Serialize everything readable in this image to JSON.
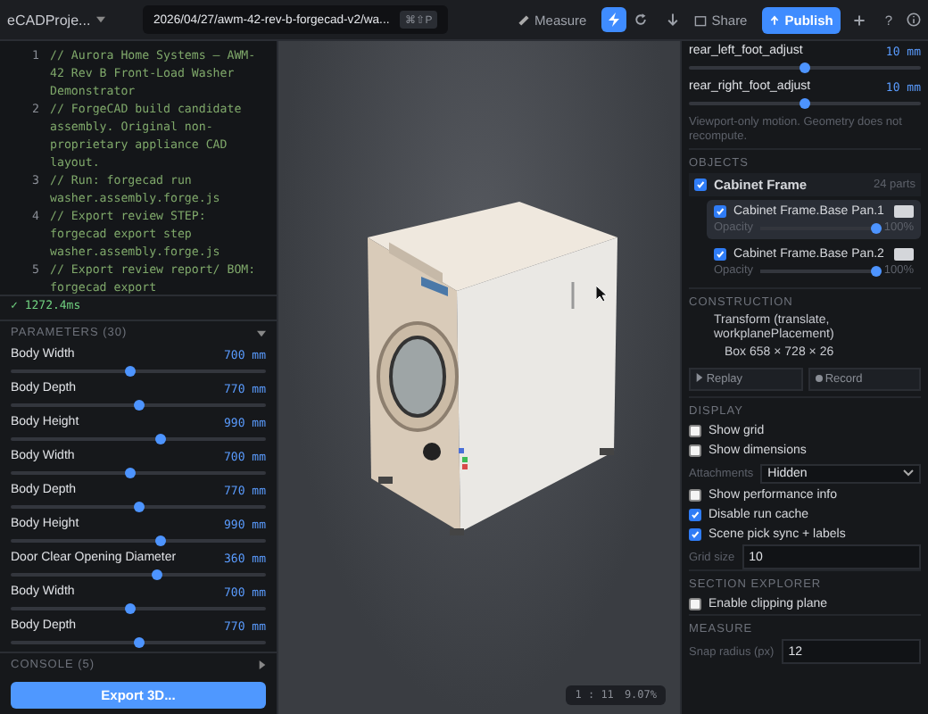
{
  "toolbar": {
    "project": "eCADProje...",
    "path": "2026/04/27/awm-42-rev-b-forgecad-v2/wa...",
    "path_shortcut": "⌘⇧P",
    "measure": "Measure",
    "run_active": true,
    "share": "Share",
    "publish": "Publish",
    "help": "?"
  },
  "editor": {
    "lines": [
      {
        "number": "1",
        "text": "// Aurora Home Systems — AWM-42 Rev B Front-Load Washer Demonstrator"
      },
      {
        "number": "2",
        "text": "// ForgeCAD build candidate assembly. Original non-proprietary appliance CAD layout."
      },
      {
        "number": "3",
        "text": "// Run: forgecad run washer.assembly.forge.js"
      },
      {
        "number": "4",
        "text": "// Export review STEP: forgecad export step washer.assembly.forge.js"
      },
      {
        "number": "5",
        "text": "// Export review report/ BOM: forgecad export"
      }
    ],
    "status": "✓ 1272.4ms"
  },
  "parameters": {
    "title": "PARAMETERS (30)",
    "items": [
      {
        "name": "Body Width",
        "value": "700 mm",
        "level": 0.47
      },
      {
        "name": "Body Depth",
        "value": "770 mm",
        "level": 0.5
      },
      {
        "name": "Body Height",
        "value": "990 mm",
        "level": 0.59
      },
      {
        "name": "Body Width",
        "value": "700 mm",
        "level": 0.47
      },
      {
        "name": "Body Depth",
        "value": "770 mm",
        "level": 0.5
      },
      {
        "name": "Body Height",
        "value": "990 mm",
        "level": 0.59
      },
      {
        "name": "Door Clear Opening Diameter",
        "value": "360 mm",
        "level": 0.57
      },
      {
        "name": "Body Width",
        "value": "700 mm",
        "level": 0.47
      },
      {
        "name": "Body Depth",
        "value": "770 mm",
        "level": 0.5
      }
    ]
  },
  "console": {
    "title": "CONSOLE (5)"
  },
  "export_button": "Export 3D...",
  "viewport": {
    "scale": "1 : 11",
    "zoom": "9.07%"
  },
  "inspector": {
    "adjusters": [
      {
        "name": "rear_left_foot_adjust",
        "value": "10 mm",
        "level": 0.5
      },
      {
        "name": "rear_right_foot_adjust",
        "value": "10 mm",
        "level": 0.5
      }
    ],
    "note": "Viewport-only motion. Geometry does not recompute.",
    "objects": {
      "title": "OBJECTS",
      "name": "Cabinet Frame",
      "checked": true,
      "count": "24 parts",
      "children": [
        {
          "name": "Cabinet Frame.Base Pan.1",
          "checked": true,
          "opacity_label": "Opacity",
          "level": 1,
          "reading": "100%",
          "selected": true
        },
        {
          "name": "Cabinet Frame.Base Pan.2",
          "checked": true,
          "opacity_label": "Opacity",
          "level": 1,
          "reading": "100%",
          "selected": false
        }
      ]
    },
    "construction": {
      "title": "CONSTRUCTION",
      "step": "Transform (translate, workplanePlacement)",
      "children": [
        {
          "label": "Box 658 × 728 × 26"
        }
      ],
      "replay": "Replay",
      "record": "Record"
    },
    "display": {
      "title": "DISPLAY",
      "items": [
        {
          "kind": "checkbox",
          "label": "Show grid",
          "checked": false
        },
        {
          "kind": "checkbox",
          "label": "Show dimensions",
          "checked": false
        },
        {
          "kind": "select",
          "label": "Attachments",
          "value": "Hidden"
        },
        {
          "kind": "checkbox",
          "label": "Show performance info",
          "checked": false
        },
        {
          "kind": "checkbox",
          "label": "Disable run cache",
          "checked": true
        },
        {
          "kind": "checkbox",
          "label": "Scene pick sync + labels",
          "checked": true
        },
        {
          "kind": "input",
          "label": "Grid size",
          "value": "10"
        }
      ]
    },
    "section_explorer": {
      "title": "SECTION EXPLORER",
      "items": [
        {
          "kind": "checkbox",
          "label": "Enable clipping plane",
          "checked": false
        }
      ]
    },
    "measure": {
      "title": "MEASURE",
      "items": [
        {
          "kind": "input",
          "label": "Snap radius (px)",
          "value": "12"
        }
      ]
    }
  }
}
